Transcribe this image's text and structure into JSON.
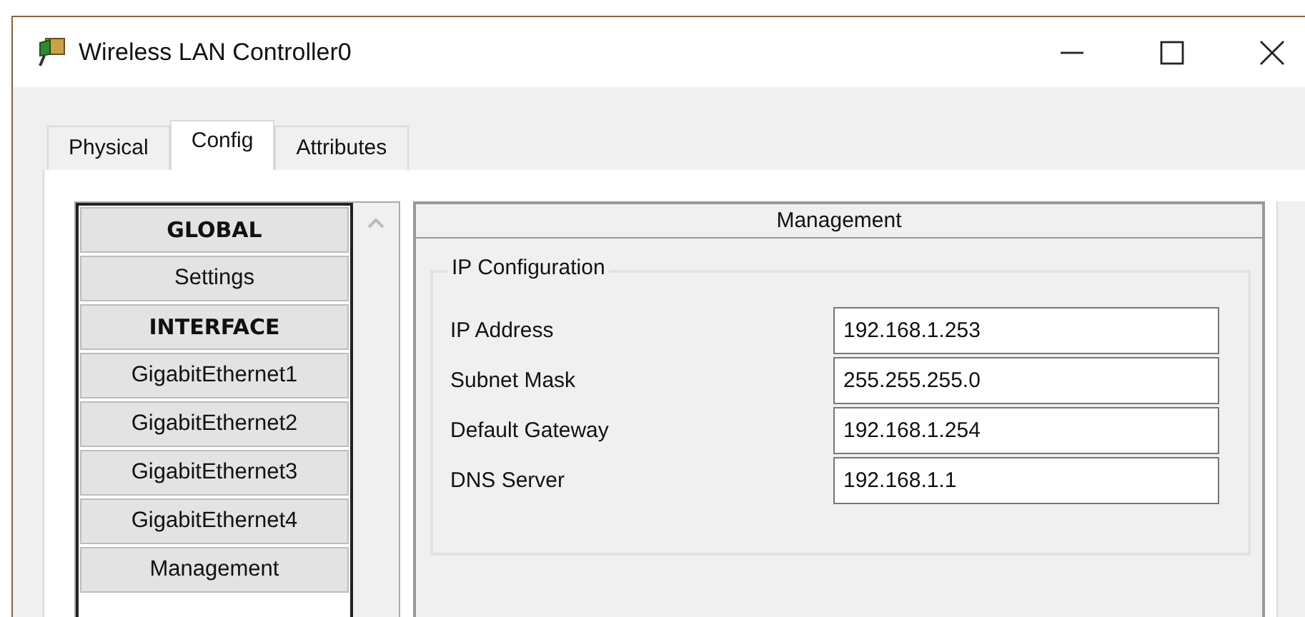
{
  "window": {
    "title": "Wireless LAN Controller0"
  },
  "tabs": [
    {
      "label": "Physical",
      "selected": false
    },
    {
      "label": "Config",
      "selected": true
    },
    {
      "label": "Attributes",
      "selected": false
    }
  ],
  "sidebar": {
    "items": [
      {
        "label": "GLOBAL",
        "kind": "header"
      },
      {
        "label": "Settings",
        "kind": "item"
      },
      {
        "label": "INTERFACE",
        "kind": "header"
      },
      {
        "label": "GigabitEthernet1",
        "kind": "item"
      },
      {
        "label": "GigabitEthernet2",
        "kind": "item"
      },
      {
        "label": "GigabitEthernet3",
        "kind": "item"
      },
      {
        "label": "GigabitEthernet4",
        "kind": "item"
      },
      {
        "label": "Management",
        "kind": "item"
      }
    ]
  },
  "panel": {
    "title": "Management",
    "group": {
      "title": "IP Configuration",
      "fields": [
        {
          "label": "IP Address",
          "value": "192.168.1.253"
        },
        {
          "label": "Subnet Mask",
          "value": "255.255.255.0"
        },
        {
          "label": "Default Gateway",
          "value": "192.168.1.254"
        },
        {
          "label": "DNS Server",
          "value": "192.168.1.1"
        }
      ]
    }
  }
}
